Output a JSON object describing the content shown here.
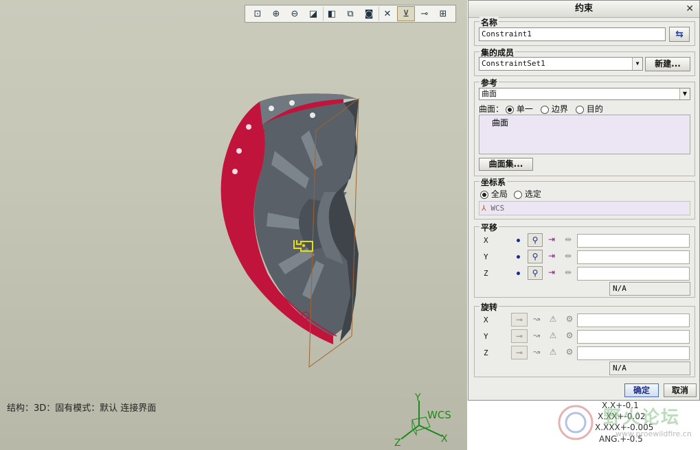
{
  "toolbar": {
    "items": [
      "zoom-window-icon",
      "zoom-in-icon",
      "zoom-out-icon",
      "refit-icon",
      "shading-icon",
      "saved-view-icon",
      "snapshot-icon",
      "datum-display-icon",
      "csys-display-icon",
      "point-display-icon",
      "component-display-icon"
    ]
  },
  "status": {
    "text": "结构：3D：固有模式：默认 连接界面"
  },
  "wcs": {
    "label": "WCS",
    "x": "X",
    "y": "Y",
    "z": "Z"
  },
  "tolerance": {
    "lines": [
      "X.X+-0.1",
      "X.XX+-0.02",
      "X.XXX+-0.005",
      "ANG.+-0.5"
    ]
  },
  "watermark": {
    "text": "野火论坛",
    "url": "www.proewildfire.cn"
  },
  "dialog": {
    "title": "约束",
    "name": {
      "legend": "名称",
      "value": "Constraint1"
    },
    "set": {
      "legend": "集的成员",
      "value": "ConstraintSet1",
      "new_button": "新建..."
    },
    "reference": {
      "legend": "参考",
      "type_value": "曲面",
      "surface_label": "曲面：",
      "options": [
        "单一",
        "边界",
        "目的"
      ],
      "selected_option": "单一",
      "list_item": "曲面",
      "surface_set_button": "曲面集..."
    },
    "csys": {
      "legend": "坐标系",
      "options": [
        "全局",
        "选定"
      ],
      "selected": "全局",
      "field_value": "WCS"
    },
    "translation": {
      "legend": "平移",
      "axes": [
        "X",
        "Y",
        "Z"
      ],
      "na": "N/A"
    },
    "rotation": {
      "legend": "旋转",
      "axes": [
        "X",
        "Y",
        "Z"
      ],
      "na": "N/A"
    },
    "ok_button": "确定",
    "cancel_button": "取消"
  },
  "colors": {
    "accent": "#1c2c80",
    "model_red": "#c0143c",
    "model_gray": "#5a6068",
    "highlight": "#e8e000",
    "list_bg": "#ece6f4"
  }
}
